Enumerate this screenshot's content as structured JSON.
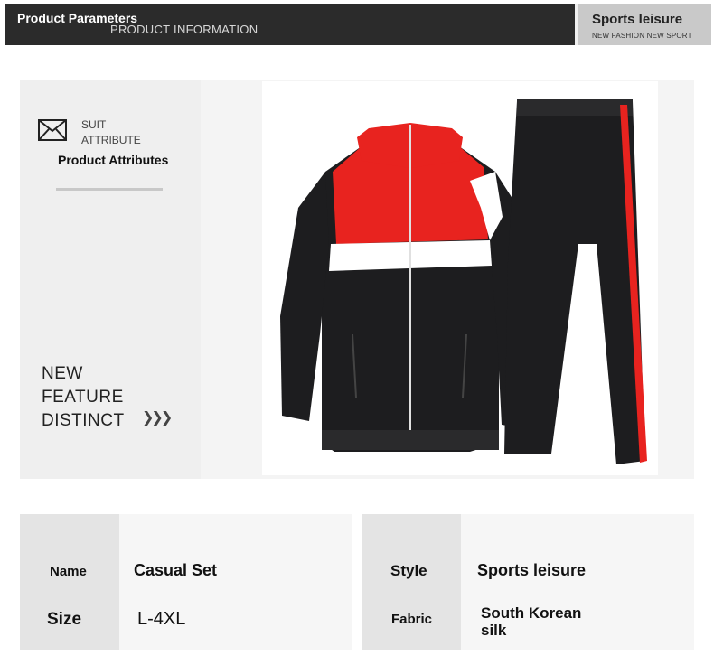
{
  "header": {
    "left_title": "Product Parameters",
    "left_subtitle": "PRODUCT INFORMATION",
    "right_title": "Sports leisure",
    "right_subtitle": "NEW FASHION NEW SPORT"
  },
  "attributes": {
    "suit": "SUIT",
    "attribute": "ATTRIBUTE",
    "title": "Product Attributes"
  },
  "feature": {
    "line1": "NEW",
    "line2": "FEATURE",
    "line3": "DISTINCT"
  },
  "specs": {
    "name_label": "Name",
    "name_value": "Casual Set",
    "size_label": "Size",
    "size_value": "L-4XL",
    "style_label": "Style",
    "style_value": "Sports leisure",
    "fabric_label": "Fabric",
    "fabric_value": "South Korean silk"
  },
  "colors": {
    "jacket_black": "#1d1d1f",
    "jacket_red": "#e8231f",
    "stripe_white": "#ffffff"
  },
  "icons": [
    "envelope-icon",
    "chevrons-right-icon"
  ]
}
